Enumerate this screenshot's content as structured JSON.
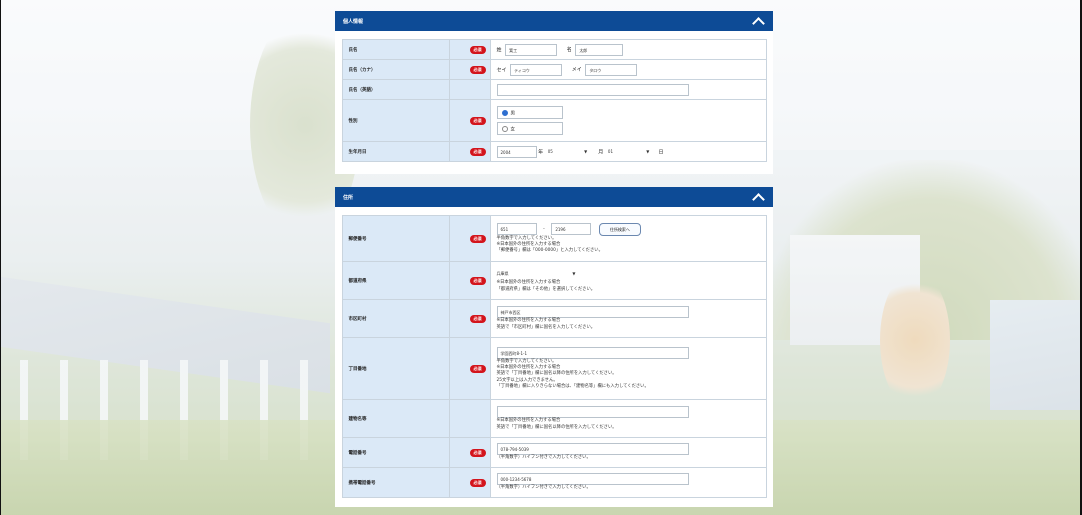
{
  "section1": {
    "title": "個人情報",
    "required_badge": "必須",
    "rows": {
      "name": {
        "label": "氏名",
        "sei_prefix": "姓",
        "sei_value": "箕工",
        "mei_prefix": "名",
        "mei_value": "太郎"
      },
      "kana": {
        "label": "氏名（カナ）",
        "sei_prefix": "セイ",
        "sei_value": "ティコウ",
        "mei_prefix": "メイ",
        "mei_value": "タロウ"
      },
      "romaji": {
        "label": "氏名（英語）",
        "value": ""
      },
      "gender": {
        "label": "性別",
        "options": [
          "男",
          "女"
        ],
        "selected": "男"
      },
      "birthday": {
        "label": "生年月日",
        "year": "2004",
        "year_suffix": "年",
        "month": "05",
        "month_suffix": "月",
        "day": "01",
        "day_suffix": "日"
      }
    }
  },
  "section2": {
    "title": "住所",
    "required_badge": "必須",
    "rows": {
      "postal": {
        "label": "郵便番号",
        "first": "651",
        "dash": "-",
        "second": "2196",
        "button": "住所検索へ",
        "help": [
          "半角数字で入力してください。",
          "※日本国外の住所を入力する場合",
          "「郵便番号」欄は「000-0000」と入力してください。"
        ]
      },
      "prefecture": {
        "label": "都道府県",
        "selected": "兵庫県",
        "help": [
          "※日本国外の住所を入力する場合",
          "「都道府県」欄は「その他」を選択してください。"
        ]
      },
      "city": {
        "label": "市区町村",
        "value": "神戸市西区",
        "help": [
          "※日本国外の住所を入力する場合",
          "英語で「市区町村」欄に国名を入力してください。"
        ]
      },
      "street": {
        "label": "丁目番地",
        "value": "学園西町8-1-1",
        "help": [
          "半角数字で入力してください。",
          "※日本国外の住所を入力する場合",
          "英語で「丁目番地」欄に国名以降の住所を入力してください。",
          "25文字以上は入力できません。",
          "「丁目番地」欄に入りきらない場合は、「建物名等」欄にも入力してください。"
        ]
      },
      "building": {
        "label": "建物名等",
        "value": "",
        "help": [
          "※日本国外の住所を入力する場合",
          "英語で「丁目番地」欄に国名以降の住所を入力してください。"
        ]
      },
      "phone": {
        "label": "電話番号",
        "value": "078-794-5039",
        "help": [
          "（半角数字）ハイフン付きで入力してください。"
        ]
      },
      "mobile": {
        "label": "携帯電話番号",
        "value": "000-1234-5678",
        "help": [
          "（半角数字）ハイフン付きで入力してください。"
        ]
      }
    }
  }
}
